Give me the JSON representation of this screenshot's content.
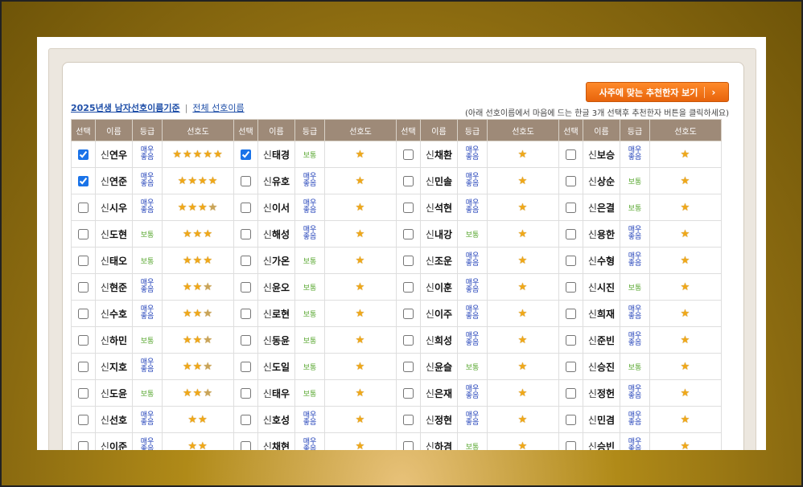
{
  "recommend_button": {
    "label": "사주에 맞는 추천한자 보기",
    "chevron": "chevron-right-icon"
  },
  "nav": {
    "active_label": "2025년생 남자선호이름기준",
    "separator": "|",
    "all_label": "전체 선호이름"
  },
  "hint": "(아래 선호이름에서 마음에 드는 한글 3개 선택후 추천한자 버튼을 클릭하세요)",
  "headers": [
    "선택",
    "이름",
    "등급",
    "선호도"
  ],
  "grade_labels": {
    "good": "매우좋음",
    "normal": "보통"
  },
  "colors": {
    "header_bg": "#9e8a78",
    "button": "#f07a1a",
    "link": "#1f4fa8",
    "grade_good": "#1f3fb8",
    "grade_normal": "#5aa832",
    "star": "#f0a818"
  },
  "surname": "신",
  "rows": [
    [
      {
        "given": "연우",
        "grade": "매우좋음",
        "stars": 5,
        "checked": true
      },
      {
        "given": "태경",
        "grade": "보통",
        "stars": 1,
        "checked": true
      },
      {
        "given": "채환",
        "grade": "매우좋음",
        "stars": 1,
        "checked": false
      },
      {
        "given": "보승",
        "grade": "매우좋음",
        "stars": 1,
        "checked": false
      }
    ],
    [
      {
        "given": "연준",
        "grade": "매우좋음",
        "stars": 4,
        "checked": true
      },
      {
        "given": "유호",
        "grade": "매우좋음",
        "stars": 1,
        "checked": false
      },
      {
        "given": "민솔",
        "grade": "매우좋음",
        "stars": 1,
        "checked": false
      },
      {
        "given": "상순",
        "grade": "보통",
        "stars": 1,
        "checked": false
      }
    ],
    [
      {
        "given": "시우",
        "grade": "매우좋음",
        "stars": 3.5,
        "checked": false
      },
      {
        "given": "이서",
        "grade": "매우좋음",
        "stars": 1,
        "checked": false
      },
      {
        "given": "석현",
        "grade": "매우좋음",
        "stars": 1,
        "checked": false
      },
      {
        "given": "은결",
        "grade": "보통",
        "stars": 1,
        "checked": false
      }
    ],
    [
      {
        "given": "도현",
        "grade": "보통",
        "stars": 3,
        "checked": false
      },
      {
        "given": "해성",
        "grade": "매우좋음",
        "stars": 1,
        "checked": false
      },
      {
        "given": "내강",
        "grade": "보통",
        "stars": 1,
        "checked": false
      },
      {
        "given": "용한",
        "grade": "매우좋음",
        "stars": 1,
        "checked": false
      }
    ],
    [
      {
        "given": "태오",
        "grade": "보통",
        "stars": 3,
        "checked": false
      },
      {
        "given": "가온",
        "grade": "보통",
        "stars": 1,
        "checked": false
      },
      {
        "given": "조운",
        "grade": "매우좋음",
        "stars": 1,
        "checked": false
      },
      {
        "given": "수형",
        "grade": "매우좋음",
        "stars": 1,
        "checked": false
      }
    ],
    [
      {
        "given": "현준",
        "grade": "매우좋음",
        "stars": 2.5,
        "checked": false
      },
      {
        "given": "윤오",
        "grade": "보통",
        "stars": 1,
        "checked": false
      },
      {
        "given": "이훈",
        "grade": "매우좋음",
        "stars": 1,
        "checked": false
      },
      {
        "given": "시진",
        "grade": "보통",
        "stars": 1,
        "checked": false
      }
    ],
    [
      {
        "given": "수호",
        "grade": "매우좋음",
        "stars": 2.5,
        "checked": false
      },
      {
        "given": "로현",
        "grade": "보통",
        "stars": 1,
        "checked": false
      },
      {
        "given": "이주",
        "grade": "매우좋음",
        "stars": 1,
        "checked": false
      },
      {
        "given": "희재",
        "grade": "매우좋음",
        "stars": 1,
        "checked": false
      }
    ],
    [
      {
        "given": "하민",
        "grade": "보통",
        "stars": 2.5,
        "checked": false
      },
      {
        "given": "동윤",
        "grade": "보통",
        "stars": 1,
        "checked": false
      },
      {
        "given": "희성",
        "grade": "매우좋음",
        "stars": 1,
        "checked": false
      },
      {
        "given": "준빈",
        "grade": "매우좋음",
        "stars": 1,
        "checked": false
      }
    ],
    [
      {
        "given": "지호",
        "grade": "매우좋음",
        "stars": 2.5,
        "checked": false
      },
      {
        "given": "도일",
        "grade": "보통",
        "stars": 1,
        "checked": false
      },
      {
        "given": "윤슬",
        "grade": "보통",
        "stars": 1,
        "checked": false
      },
      {
        "given": "승진",
        "grade": "보통",
        "stars": 1,
        "checked": false
      }
    ],
    [
      {
        "given": "도윤",
        "grade": "보통",
        "stars": 2.5,
        "checked": false
      },
      {
        "given": "태우",
        "grade": "보통",
        "stars": 1,
        "checked": false
      },
      {
        "given": "은재",
        "grade": "매우좋음",
        "stars": 1,
        "checked": false
      },
      {
        "given": "정헌",
        "grade": "매우좋음",
        "stars": 1,
        "checked": false
      }
    ],
    [
      {
        "given": "선호",
        "grade": "매우좋음",
        "stars": 2,
        "checked": false
      },
      {
        "given": "호성",
        "grade": "매우좋음",
        "stars": 1,
        "checked": false
      },
      {
        "given": "정현",
        "grade": "매우좋음",
        "stars": 1,
        "checked": false
      },
      {
        "given": "민겸",
        "grade": "매우좋음",
        "stars": 1,
        "checked": false
      }
    ],
    [
      {
        "given": "이준",
        "grade": "매우좋음",
        "stars": 2,
        "checked": false
      },
      {
        "given": "채현",
        "grade": "매우좋음",
        "stars": 1,
        "checked": false
      },
      {
        "given": "하겸",
        "grade": "보통",
        "stars": 1,
        "checked": false
      },
      {
        "given": "승빈",
        "grade": "매우좋음",
        "stars": 1,
        "checked": false
      }
    ]
  ]
}
